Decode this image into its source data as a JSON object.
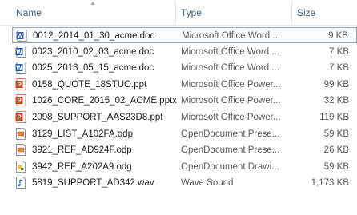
{
  "header": {
    "name": "Name",
    "type": "Type",
    "size": "Size"
  },
  "files": [
    {
      "name": "0012_2014_01_30_acme.doc",
      "type": "Microsoft Office Word ...",
      "size": "9 KB",
      "icon": "word-icon",
      "selected": true
    },
    {
      "name": "0023_2010_02_03_acme.doc",
      "type": "Microsoft Office Word ...",
      "size": "7 KB",
      "icon": "word-icon"
    },
    {
      "name": "0025_2013_05_15_acme.doc",
      "type": "Microsoft Office Word ...",
      "size": "7 KB",
      "icon": "word-icon"
    },
    {
      "name": "0158_QUOTE_18STUO.ppt",
      "type": "Microsoft Office Power...",
      "size": "99 KB",
      "icon": "powerpoint-icon"
    },
    {
      "name": "1026_CORE_2015_02_ACME.pptx",
      "type": "Microsoft Office Power...",
      "size": "32 KB",
      "icon": "powerpoint-icon"
    },
    {
      "name": "2098_SUPPORT_AAS23D8.ppt",
      "type": "Microsoft Office Power...",
      "size": "119 KB",
      "icon": "powerpoint-icon"
    },
    {
      "name": "3129_LIST_A102FA.odp",
      "type": "OpenDocument Prese...",
      "size": "59 KB",
      "icon": "odp-icon"
    },
    {
      "name": "3921_REF_AD924F.odp",
      "type": "OpenDocument Prese...",
      "size": "26 KB",
      "icon": "odp-icon"
    },
    {
      "name": "3942_REF_A202A9.odg",
      "type": "OpenDocument Drawi...",
      "size": "59 KB",
      "icon": "odg-icon"
    },
    {
      "name": "5819_SUPPORT_AD342.wav",
      "type": "Wave Sound",
      "size": "1,173 KB",
      "icon": "audio-icon"
    }
  ]
}
